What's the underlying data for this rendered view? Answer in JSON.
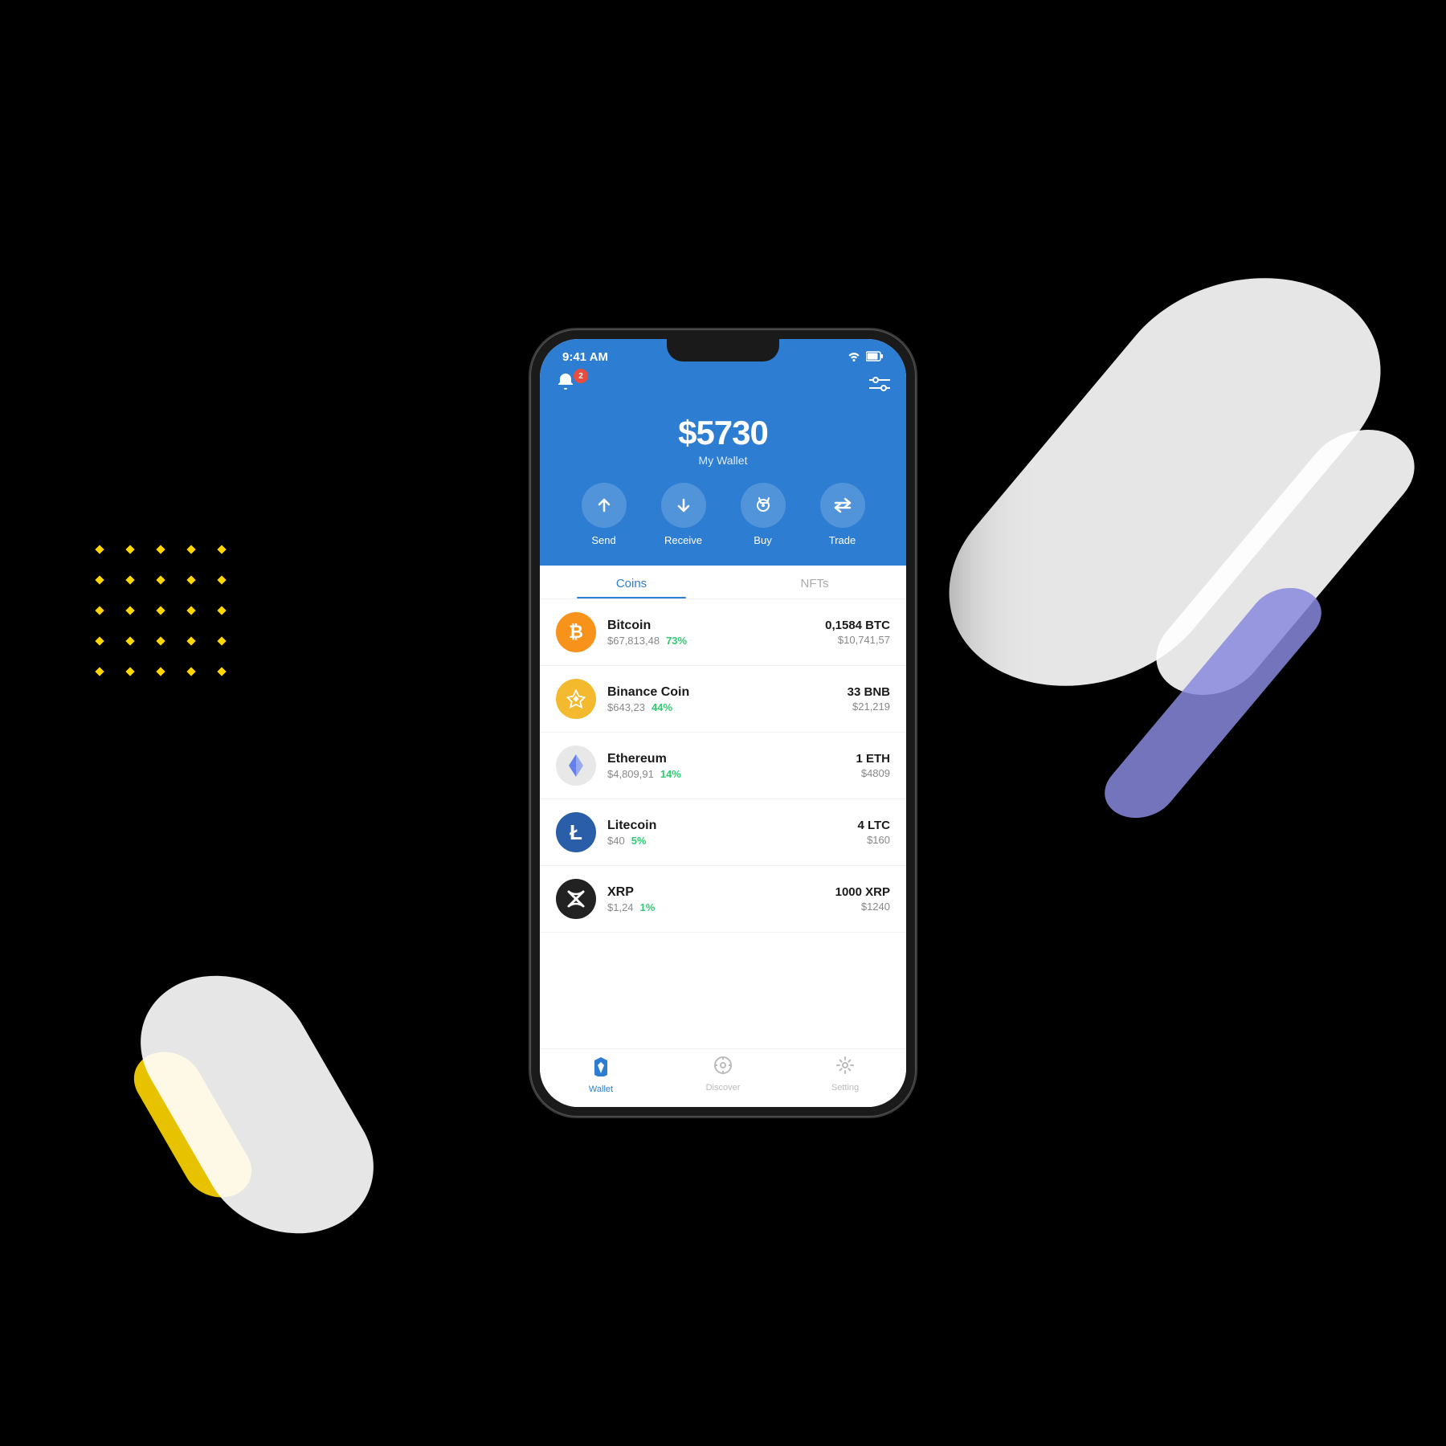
{
  "background": "#000000",
  "decorations": {
    "dotGrid": true,
    "ribbons": [
      "white-right",
      "blue-right",
      "yellow-left",
      "white-left"
    ]
  },
  "statusBar": {
    "time": "9:41 AM",
    "wifiIcon": "wifi",
    "batteryIcon": "battery"
  },
  "header": {
    "notificationBadge": "2",
    "balanceAmount": "$5730",
    "balanceLabel": "My Wallet",
    "actions": [
      {
        "id": "send",
        "label": "Send",
        "icon": "↑"
      },
      {
        "id": "receive",
        "label": "Receive",
        "icon": "↓"
      },
      {
        "id": "buy",
        "label": "Buy",
        "icon": "🏷"
      },
      {
        "id": "trade",
        "label": "Trade",
        "icon": "⇄"
      }
    ]
  },
  "tabs": [
    {
      "id": "coins",
      "label": "Coins",
      "active": true
    },
    {
      "id": "nfts",
      "label": "NFTs",
      "active": false
    }
  ],
  "coins": [
    {
      "id": "btc",
      "name": "Bitcoin",
      "price": "$67,813,48",
      "change": "73%",
      "amount": "0,1584 BTC",
      "value": "$10,741,57",
      "colorClass": "btc",
      "symbol": "₿"
    },
    {
      "id": "bnb",
      "name": "Binance Coin",
      "price": "$643,23",
      "change": "44%",
      "amount": "33 BNB",
      "value": "$21,219",
      "colorClass": "bnb",
      "symbol": "◈"
    },
    {
      "id": "eth",
      "name": "Ethereum",
      "price": "$4,809,91",
      "change": "14%",
      "amount": "1 ETH",
      "value": "$4809",
      "colorClass": "eth",
      "symbol": "⬡"
    },
    {
      "id": "ltc",
      "name": "Litecoin",
      "price": "$40",
      "change": "5%",
      "amount": "4 LTC",
      "value": "$160",
      "colorClass": "ltc",
      "symbol": "Ł"
    },
    {
      "id": "xrp",
      "name": "XRP",
      "price": "$1,24",
      "change": "1%",
      "amount": "1000 XRP",
      "value": "$1240",
      "colorClass": "xrp",
      "symbol": "✕"
    }
  ],
  "bottomNav": [
    {
      "id": "wallet",
      "label": "Wallet",
      "icon": "🛡",
      "active": true
    },
    {
      "id": "discover",
      "label": "Discover",
      "icon": "◎",
      "active": false
    },
    {
      "id": "setting",
      "label": "Setting",
      "icon": "⚙",
      "active": false
    }
  ]
}
